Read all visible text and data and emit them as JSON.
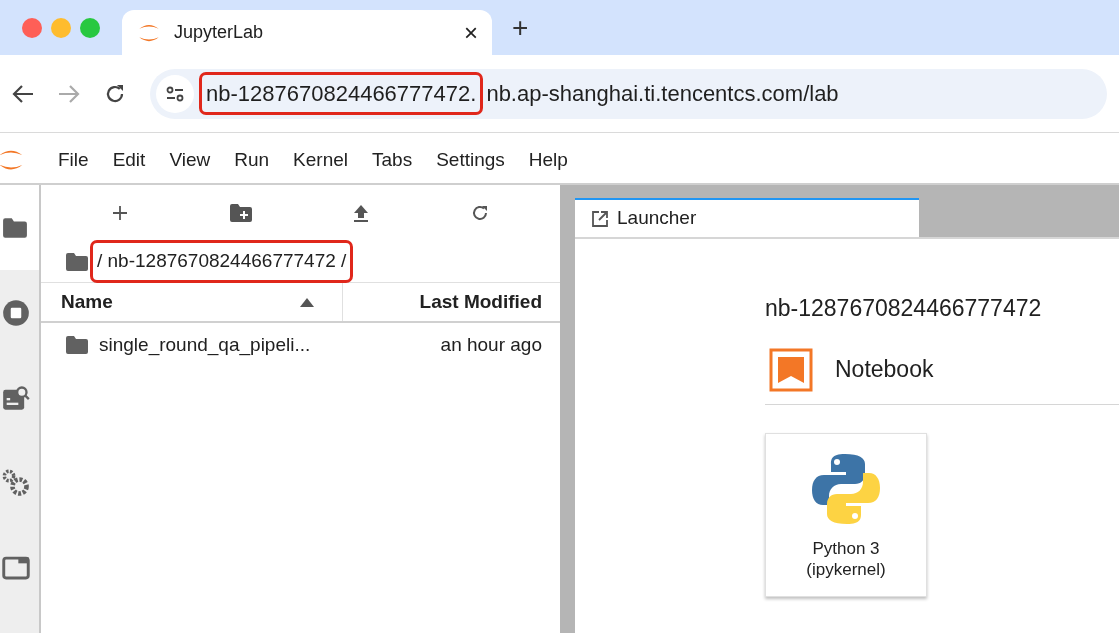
{
  "browser": {
    "tab": {
      "title": "JupyterLab",
      "close": "×"
    },
    "new_tab": "+",
    "url_parts": [
      {
        "text": "nb-1287670824466777472.",
        "highlighted": true
      },
      {
        "text": "nb.ap-shanghai.ti.tencentcs.com/lab",
        "highlighted": false
      }
    ]
  },
  "menu": [
    "File",
    "Edit",
    "View",
    "Run",
    "Kernel",
    "Tabs",
    "Settings",
    "Help"
  ],
  "activity_bar": [
    {
      "kind": "folder",
      "selected": true
    },
    {
      "kind": "running",
      "selected": false
    },
    {
      "kind": "inspector",
      "selected": false
    },
    {
      "kind": "extensions",
      "selected": false
    },
    {
      "kind": "tabs",
      "selected": false
    }
  ],
  "file_browser": {
    "breadcrumb": {
      "text": "/ nb-1287670824466777472 /",
      "highlighted": true
    },
    "columns": [
      {
        "label": "Name",
        "sorted": true
      },
      {
        "label": "Last Modified",
        "sorted": false
      }
    ],
    "rows": [
      {
        "name": "single_round_qa_pipeli...",
        "modified": "an hour ago",
        "selected": false
      }
    ]
  },
  "launcher": {
    "tab": {
      "label": "Launcher",
      "selected": true
    },
    "heading": "nb-1287670824466777472",
    "section": "Notebook",
    "cards": [
      {
        "label": "Python 3\n(ipykernel)"
      }
    ]
  }
}
